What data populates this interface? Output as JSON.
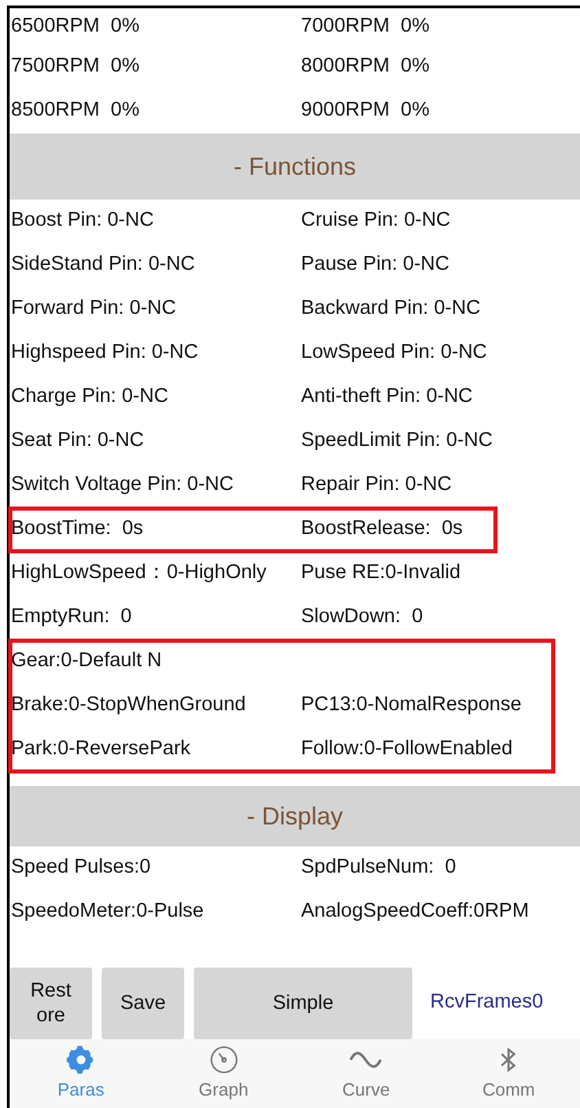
{
  "rpm_rows": [
    {
      "left": "6500RPM  0%",
      "right": "7000RPM  0%"
    },
    {
      "left": "7500RPM  0%",
      "right": "8000RPM  0%"
    },
    {
      "left": "8500RPM  0%",
      "right": "9000RPM  0%"
    }
  ],
  "functions": {
    "title": "- Functions",
    "groups": [
      {
        "highlighted": false,
        "rows": [
          {
            "left": "Boost Pin: 0-NC",
            "right": "Cruise Pin: 0-NC"
          },
          {
            "left": "SideStand Pin: 0-NC",
            "right": "Pause Pin: 0-NC"
          },
          {
            "left": "Forward Pin: 0-NC",
            "right": "Backward Pin: 0-NC"
          },
          {
            "left": "Highspeed Pin: 0-NC",
            "right": "LowSpeed Pin: 0-NC"
          },
          {
            "left": "Charge Pin: 0-NC",
            "right": "Anti-theft Pin: 0-NC"
          },
          {
            "left": "Seat Pin: 0-NC",
            "right": "SpeedLimit Pin: 0-NC"
          },
          {
            "left": "Switch Voltage Pin: 0-NC",
            "right": "Repair Pin: 0-NC"
          }
        ]
      },
      {
        "highlighted": true,
        "rows": [
          {
            "left": "BoostTime:  0s",
            "right": "BoostRelease:  0s"
          }
        ]
      },
      {
        "highlighted": false,
        "rows": [
          {
            "left": "HighLowSpeed：0-HighOnly",
            "right": "Puse RE:0-Invalid"
          },
          {
            "left": "EmptyRun:  0",
            "right": "SlowDown:  0"
          }
        ]
      },
      {
        "highlighted": true,
        "rows": [
          {
            "left": "Gear:0-Default N"
          },
          {
            "left": "Brake:0-StopWhenGround",
            "right": "PC13:0-NomalResponse"
          },
          {
            "left": "Park:0-ReversePark",
            "right": "Follow:0-FollowEnabled"
          }
        ]
      }
    ]
  },
  "display": {
    "title": "- Display",
    "rows": [
      {
        "left": "Speed Pulses:0",
        "right": "SpdPulseNum:  0"
      },
      {
        "left": "SpeedoMeter:0-Pulse",
        "right": "AnalogSpeedCoeff:0RPM"
      }
    ]
  },
  "buttons": [
    {
      "label": "Restore",
      "kind": "narrow"
    },
    {
      "label": "Save",
      "kind": "narrow"
    },
    {
      "label": "Simple",
      "kind": "wide"
    }
  ],
  "status": "RcvFrames0",
  "tabs": [
    {
      "label": "Paras",
      "kind": "gear",
      "selected": true
    },
    {
      "label": "Graph",
      "kind": "gauge",
      "selected": false
    },
    {
      "label": "Curve",
      "kind": "wave",
      "selected": false
    },
    {
      "label": "Comm",
      "kind": "bluetooth",
      "selected": false
    }
  ]
}
